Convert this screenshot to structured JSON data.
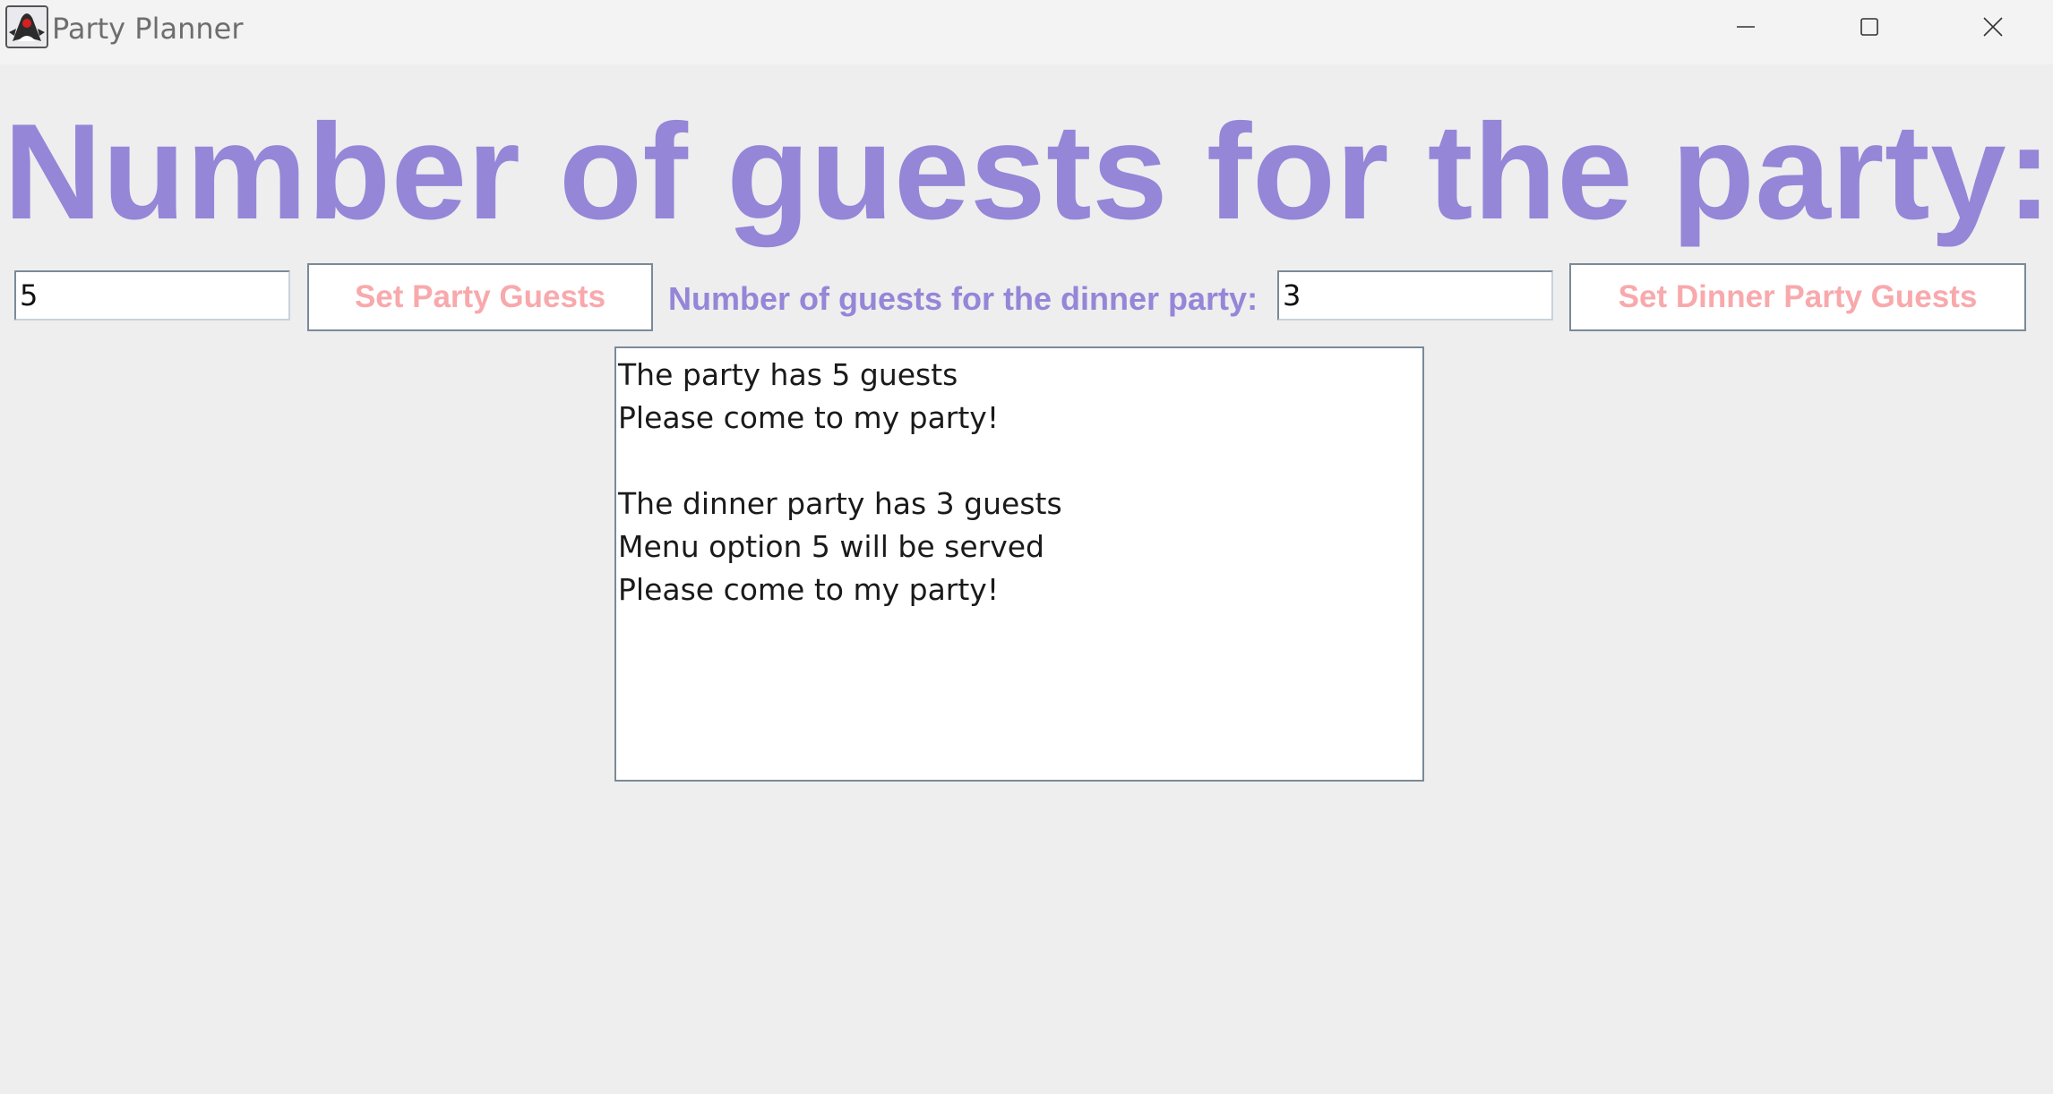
{
  "window": {
    "title": "Party Planner",
    "icon": "java-duke-icon"
  },
  "heading": "Number of guests for the party:",
  "party_guests_input": {
    "value": "5"
  },
  "set_party_guests_button": {
    "label": "Set Party Guests"
  },
  "dinner_label": "Number of guests for the dinner party:",
  "dinner_guests_input": {
    "value": "3"
  },
  "set_dinner_guests_button": {
    "label": "Set Dinner Party Guests"
  },
  "output": {
    "lines": [
      "The party has 5 guests",
      "Please come to my party!",
      "",
      "The dinner party has 3 guests",
      "Menu option 5 will be served",
      "Please come to my party!"
    ]
  },
  "colors": {
    "heading": "#9586d8",
    "button_text": "#f8a9ac",
    "background": "#eeeeee"
  }
}
